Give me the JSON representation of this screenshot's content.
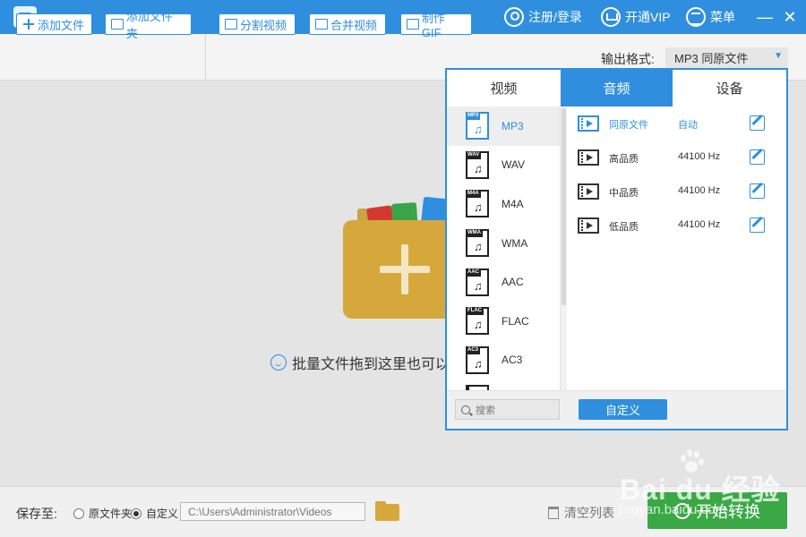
{
  "titlebar": {
    "register_label": "注册/登录",
    "vip_label": "开通VIP",
    "menu_label": "菜单"
  },
  "toolbar": {
    "add_file": "添加文件",
    "add_folder": "添加文件夹",
    "split_video": "分割视频",
    "merge_video": "合并视频",
    "make_gif": "制作GIF",
    "output_format_label": "输出格式:",
    "output_format_value": "MP3  同原文件"
  },
  "main": {
    "drop_hint": "批量文件拖到这里也可以"
  },
  "format_popup": {
    "tabs": [
      "视频",
      "音频",
      "设备"
    ],
    "active_tab": 1,
    "formats": [
      {
        "tag": "MP3",
        "label": "MP3"
      },
      {
        "tag": "WAV",
        "label": "WAV"
      },
      {
        "tag": "M4A",
        "label": "M4A"
      },
      {
        "tag": "WMA",
        "label": "WMA"
      },
      {
        "tag": "AAC",
        "label": "AAC"
      },
      {
        "tag": "FLAC",
        "label": "FLAC"
      },
      {
        "tag": "AC3",
        "label": "AC3"
      },
      {
        "tag": "",
        "label": ""
      }
    ],
    "selected_format": 0,
    "qualities": [
      {
        "name": "同原文件",
        "value": "自动"
      },
      {
        "name": "高品质",
        "value": "44100 Hz"
      },
      {
        "name": "中品质",
        "value": "44100 Hz"
      },
      {
        "name": "低品质",
        "value": "44100 Hz"
      }
    ],
    "search_placeholder": "搜索",
    "custom_label": "自定义"
  },
  "bottom": {
    "save_to_label": "保存至:",
    "radio_original": "原文件夹",
    "radio_custom": "自定义",
    "path_value": "C:\\Users\\Administrator\\Videos",
    "clear_list": "清空列表",
    "start_convert": "开始转换"
  },
  "watermark": {
    "brand": "Bai du 经验",
    "url": "jingyan.baidu.com"
  },
  "colors": {
    "accent": "#2f8fde",
    "start_button": "#39a845",
    "folder": "#d6a83c"
  }
}
